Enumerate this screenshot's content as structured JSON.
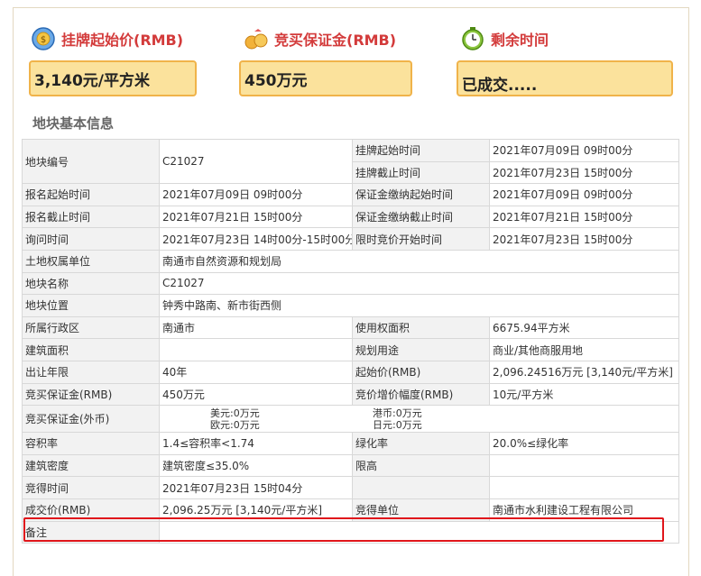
{
  "header": {
    "start_price_label": "挂牌起始价(RMB)",
    "deposit_label": "竞买保证金(RMB)",
    "remaining_label": "剩余时间",
    "start_price_value": "3,140元/平方米",
    "deposit_value": "450万元",
    "remaining_value": "已成交....."
  },
  "section_title": "地块基本信息",
  "table": {
    "r1": {
      "l1": "地块编号",
      "v1": "C21027",
      "l2a": "挂牌起始时间",
      "v2a": "2021年07月09日 09时00分",
      "l2b": "挂牌截止时间",
      "v2b": "2021年07月23日 15时00分"
    },
    "r2": {
      "l1": "报名起始时间",
      "v1": "2021年07月09日 09时00分",
      "l2": "保证金缴纳起始时间",
      "v2": "2021年07月09日 09时00分"
    },
    "r3": {
      "l1": "报名截止时间",
      "v1": "2021年07月21日 15时00分",
      "l2": "保证金缴纳截止时间",
      "v2": "2021年07月21日 15时00分"
    },
    "r4": {
      "l1": "询问时间",
      "v1": "2021年07月23日 14时00分-15时00分",
      "l2": "限时竞价开始时间",
      "v2": "2021年07月23日 15时00分"
    },
    "r5": {
      "l1": "土地权属单位",
      "v1": "南通市自然资源和规划局"
    },
    "r6": {
      "l1": "地块名称",
      "v1": "C21027"
    },
    "r7": {
      "l1": "地块位置",
      "v1": "钟秀中路南、新市街西侧"
    },
    "r8": {
      "l1": "所属行政区",
      "v1": "南通市",
      "l2": "使用权面积",
      "v2": "6675.94平方米"
    },
    "r9": {
      "l1": "建筑面积",
      "v1": "",
      "l2": "规划用途",
      "v2": "商业/其他商服用地"
    },
    "r10": {
      "l1": "出让年限",
      "v1": "40年",
      "l2": "起始价(RMB)",
      "v2": "2,096.24516万元 [3,140元/平方米]"
    },
    "r11": {
      "l1": "竞买保证金(RMB)",
      "v1": "450万元",
      "l2": "竞价增价幅度(RMB)",
      "v2": "10元/平方米"
    },
    "r12": {
      "l1": "竞买保证金(外币)",
      "usd_k": "美元:",
      "usd_v": "0万元",
      "eur_k": "欧元:",
      "eur_v": "0万元",
      "hkd_k": "港币:",
      "hkd_v": "0万元",
      "jpy_k": "日元:",
      "jpy_v": "0万元"
    },
    "r13": {
      "l1": "容积率",
      "v1": "1.4≤容积率<1.74",
      "l2": "绿化率",
      "v2": "20.0%≤绿化率"
    },
    "r14": {
      "l1": "建筑密度",
      "v1": "建筑密度≤35.0%",
      "l2": "限高",
      "v2": ""
    },
    "r15": {
      "l1": "竞得时间",
      "v1": "2021年07月23日 15时04分"
    },
    "r16": {
      "l1": "成交价(RMB)",
      "v1": "2,096.25万元 [3,140元/平方米]",
      "l2": "竞得单位",
      "v2": "南通市水利建设工程有限公司"
    },
    "r17": {
      "l1": "备注",
      "v1": ""
    }
  }
}
